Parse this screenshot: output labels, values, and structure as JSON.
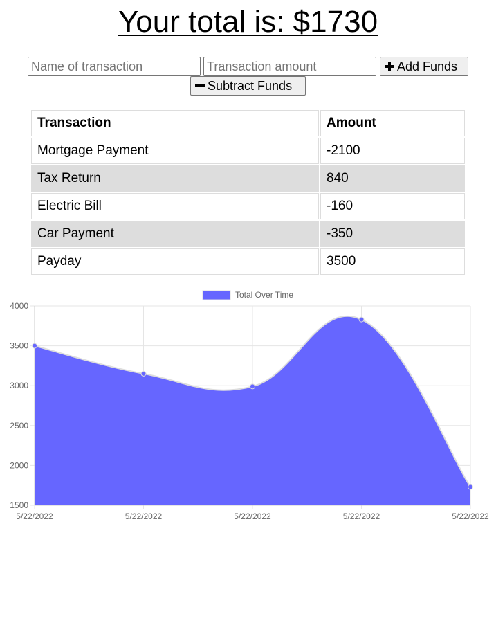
{
  "header": {
    "total_text": "Your total is: $1730"
  },
  "form": {
    "name_placeholder": "Name of transaction",
    "amount_placeholder": "Transaction amount",
    "add_label": "Add Funds",
    "subtract_label": "Subtract Funds",
    "add_icon": "plus-icon",
    "subtract_icon": "minus-icon"
  },
  "table": {
    "headers": [
      "Transaction",
      "Amount"
    ],
    "rows": [
      {
        "name": "Mortgage Payment",
        "amount": "-2100"
      },
      {
        "name": "Tax Return",
        "amount": "840"
      },
      {
        "name": "Electric Bill",
        "amount": "-160"
      },
      {
        "name": "Car Payment",
        "amount": "-350"
      },
      {
        "name": "Payday",
        "amount": "3500"
      }
    ]
  },
  "chart_data": {
    "type": "area",
    "legend": [
      "Total Over Time"
    ],
    "legend_position": "top",
    "x": [
      "5/22/2022",
      "5/22/2022",
      "5/22/2022",
      "5/22/2022",
      "5/22/2022"
    ],
    "series": [
      {
        "name": "Total Over Time",
        "values": [
          3500,
          3150,
          2990,
          3830,
          1730
        ]
      }
    ],
    "y_ticks": [
      1500,
      2000,
      2500,
      3000,
      3500,
      4000
    ],
    "ylim": [
      1500,
      4000
    ],
    "grid": true,
    "fill_color": "#6666ff",
    "line_color": "#dddddd"
  }
}
